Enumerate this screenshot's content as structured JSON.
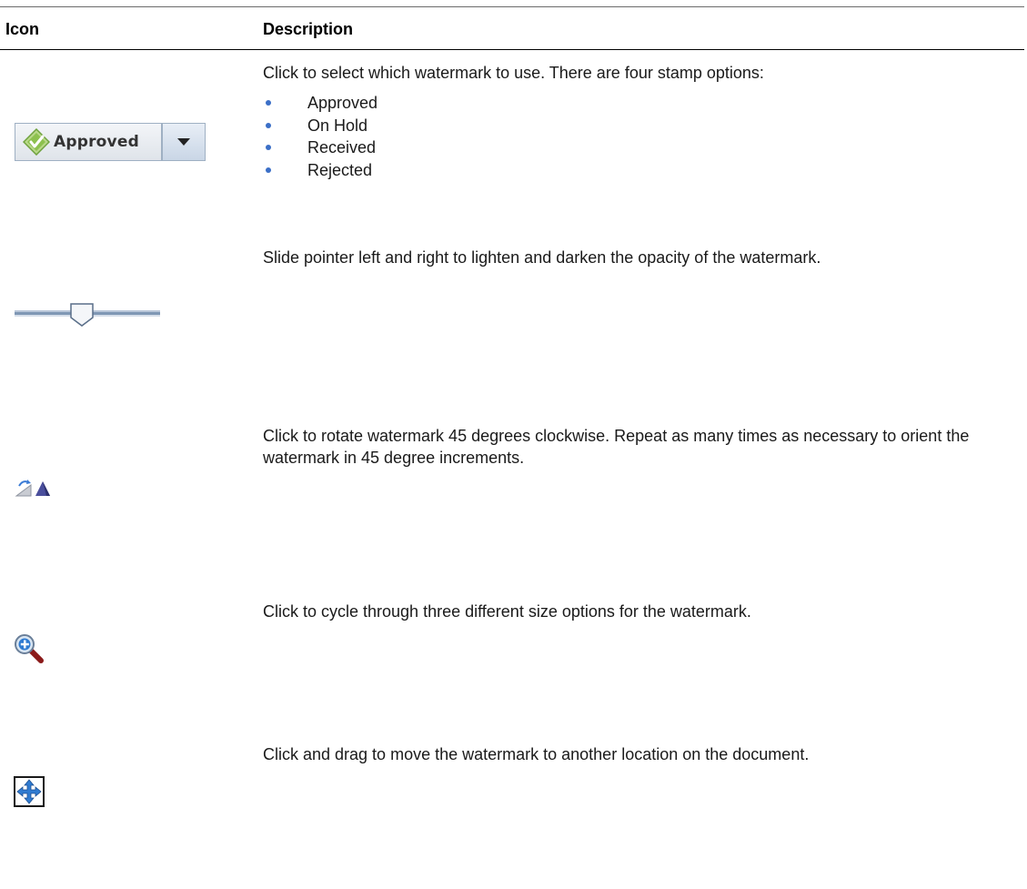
{
  "table": {
    "header": {
      "icon": "Icon",
      "description": "Description"
    },
    "rows": [
      {
        "icon": "approved-watermark-dropdown",
        "combo_label": "Approved",
        "description": "Click to select which watermark to use. There are four stamp options:",
        "options": [
          "Approved",
          "On Hold",
          "Received",
          "Rejected"
        ]
      },
      {
        "icon": "opacity-slider",
        "description": "Slide pointer left and right to lighten and darken the opacity of the watermark."
      },
      {
        "icon": "rotate-icon",
        "description": "Click to rotate watermark 45 degrees clockwise. Repeat as many times as necessary to orient the watermark in 45 degree increments."
      },
      {
        "icon": "zoom-in-icon",
        "description": "Click to cycle through three different size options for the watermark."
      },
      {
        "icon": "move-icon",
        "description": "Click and drag to move the watermark to another location on the document."
      }
    ]
  },
  "colors": {
    "bullet": "#3b6fc7",
    "rule": "#000000"
  }
}
